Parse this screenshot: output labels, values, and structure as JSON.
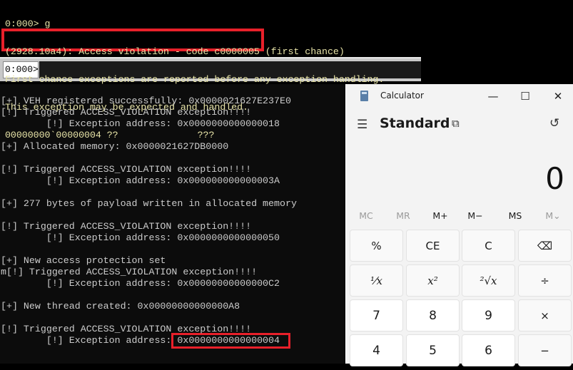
{
  "windbg": {
    "output": [
      "0:000> g",
      "(2928.10a4): Access violation - code c0000005 (first chance)",
      "First chance exceptions are reported before any exception handling.",
      "This exception may be expected and handled.",
      "00000000`00000004 ??              ???"
    ],
    "prompt": "0:000>",
    "command_value": ""
  },
  "console": {
    "lines": [
      "[+] VEH registered successfully: 0x0000021627E237E0",
      "[!] Triggered ACCESS_VIOLATION exception!!!!",
      "        [!] Exception address: 0x0000000000000018",
      "",
      "[+] Allocated memory: 0x0000021627DB0000",
      "",
      "[!] Triggered ACCESS_VIOLATION exception!!!!",
      "        [!] Exception address: 0x000000000000003A",
      "",
      "[+] 277 bytes of payload written in allocated memory",
      "",
      "[!] Triggered ACCESS_VIOLATION exception!!!!",
      "        [!] Exception address: 0x0000000000000050",
      "",
      "[+] New access protection set",
      "m[!] Triggered ACCESS_VIOLATION exception!!!!",
      "        [!] Exception address: 0x00000000000000C2",
      "",
      "[+] New thread created: 0x00000000000000A8",
      "",
      "[!] Triggered ACCESS_VIOLATION exception!!!!",
      "        [!] Exception address: 0x0000000000000004"
    ]
  },
  "highlight_color": "#e8202a",
  "calculator": {
    "title": "Calculator",
    "window_buttons": {
      "minimize": "—",
      "maximize": "☐",
      "close": "✕"
    },
    "menu_icon": "☰",
    "mode": "Standard",
    "keep_on_top_icon": "⧉",
    "history_icon": "↺",
    "display": "0",
    "memory": [
      {
        "label": "MC",
        "enabled": false
      },
      {
        "label": "MR",
        "enabled": false
      },
      {
        "label": "M+",
        "enabled": true
      },
      {
        "label": "M−",
        "enabled": true
      },
      {
        "label": "MS",
        "enabled": true
      },
      {
        "label": "M⌄",
        "enabled": false
      }
    ],
    "keys": [
      [
        "%",
        "CE",
        "C",
        "⌫"
      ],
      [
        "¹⁄x",
        "x²",
        "²√x",
        "÷"
      ],
      [
        "7",
        "8",
        "9",
        "×"
      ],
      [
        "4",
        "5",
        "6",
        "−"
      ]
    ]
  }
}
